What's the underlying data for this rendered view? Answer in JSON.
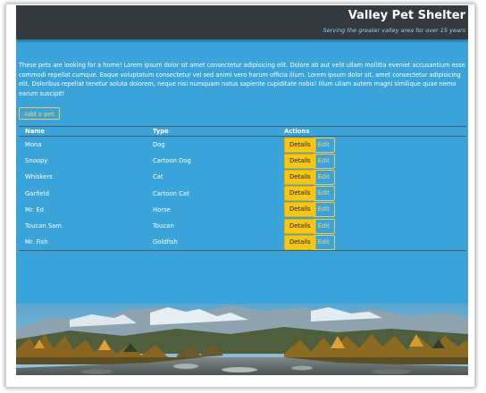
{
  "header": {
    "title": "Valley Pet Shelter",
    "subtitle": "Serving the greater valley area for over 15 years"
  },
  "intro": {
    "text": "These pets are looking for a home! Lorem ipsum dolor sit amet consectetur adipisicing elit. Dolore ab aut velit ullam mollitia eveniet accusantium esse commodi repellat cumque. Eaque voluptatum consectetur vel sed animi vero harum officia illum. Lorem ipsum dolor sit, amet consectetur adipisicing elit. Doloribus repellat tenetur soluta dolorem, neque nisi numquam natus sapiente cupiditate nobis! Illum ullam autem magni similique quae nemo earum suscipit!"
  },
  "add_button": {
    "label": "Add a pet"
  },
  "table": {
    "headers": {
      "name": "Name",
      "type": "Type",
      "actions": "Actions"
    },
    "rows": [
      {
        "name": "Mona",
        "type": "Dog"
      },
      {
        "name": "Snoopy",
        "type": "Cartoon Dog"
      },
      {
        "name": "Whiskers",
        "type": "Cat"
      },
      {
        "name": "Garfield",
        "type": "Cartoon Cat"
      },
      {
        "name": "Mr. Ed",
        "type": "Horse"
      },
      {
        "name": "Toucan Sam",
        "type": "Toucan"
      },
      {
        "name": "Mr. Fish",
        "type": "Goldfish"
      }
    ],
    "details_label": "Details",
    "edit_label": "Edit"
  },
  "colors": {
    "page_background": "#3aa3d9",
    "header_background": "#343a40",
    "accent_yellow": "#f5c518",
    "subtitle_color": "#8fd4ff"
  }
}
